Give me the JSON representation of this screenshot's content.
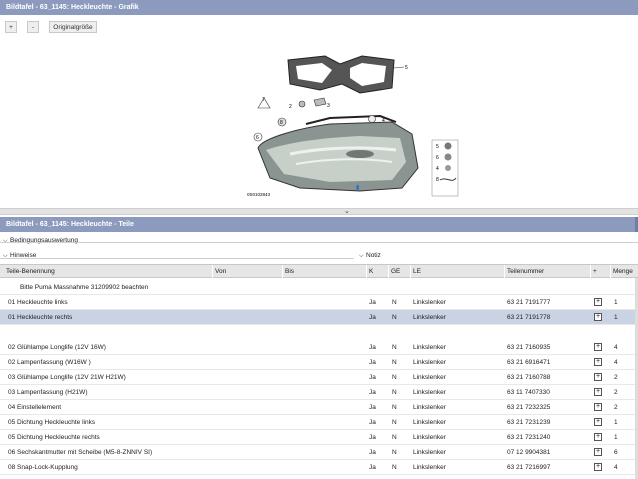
{
  "window": {
    "graphic_title": "Bildtafel - 63_1145: Heckleuchte - Grafik",
    "parts_title": "Bildtafel - 63_1145: Heckleuchte - Teile"
  },
  "toolbar": {
    "zoom_in": "+",
    "zoom_out": "-",
    "original_size": "Originalgröße"
  },
  "diagram": {
    "callouts": [
      "1",
      "2",
      "3",
      "4",
      "5",
      "6",
      "7",
      "8"
    ],
    "code": "0S0102843"
  },
  "splitter_icon": "chevron-down-icon",
  "sections": {
    "conditions": "Bedingungsauswertung",
    "hints": "Hinweise",
    "notes": "Notiz"
  },
  "table": {
    "columns": [
      "Teile-Benennung",
      "Von",
      "Bis",
      "K",
      "GE",
      "LE",
      "Teilenummer",
      "+",
      "Menge"
    ],
    "note_row": "Bitte Puma Massnahme 31209902 beachten",
    "rows": [
      {
        "name": "01 Heckleuchte links",
        "k": "Ja",
        "ge": "N",
        "le": "Linkslenker",
        "part": "63 21 7191777",
        "qty": "1"
      },
      {
        "name": "01 Heckleuchte rechts",
        "k": "Ja",
        "ge": "N",
        "le": "Linkslenker",
        "part": "63 21 7191778",
        "qty": "1"
      },
      {
        "name": "02 Glühlampe Longlife (12V 16W)",
        "k": "Ja",
        "ge": "N",
        "le": "Linkslenker",
        "part": "63 21 7160935",
        "qty": "4"
      },
      {
        "name": "02 Lampenfassung (W16W )",
        "k": "Ja",
        "ge": "N",
        "le": "Linkslenker",
        "part": "63 21 6916471",
        "qty": "4"
      },
      {
        "name": "03 Glühlampe Longlife (12V 21W H21W)",
        "k": "Ja",
        "ge": "N",
        "le": "Linkslenker",
        "part": "63 21 7160788",
        "qty": "2"
      },
      {
        "name": "03 Lampenfassung (H21W)",
        "k": "Ja",
        "ge": "N",
        "le": "Linkslenker",
        "part": "63 11 7407330",
        "qty": "2"
      },
      {
        "name": "04 Einstellelement",
        "k": "Ja",
        "ge": "N",
        "le": "Linkslenker",
        "part": "63 21 7232325",
        "qty": "2"
      },
      {
        "name": "05 Dichtung Heckleuchte links",
        "k": "Ja",
        "ge": "N",
        "le": "Linkslenker",
        "part": "63 21 7231239",
        "qty": "1"
      },
      {
        "name": "05 Dichtung Heckleuchte rechts",
        "k": "Ja",
        "ge": "N",
        "le": "Linkslenker",
        "part": "63 21 7231240",
        "qty": "1"
      },
      {
        "name": "06 Sechskantmutter mit Scheibe (M5-8-ZNNIV SI)",
        "k": "Ja",
        "ge": "N",
        "le": "Linkslenker",
        "part": "07 12 9904381",
        "qty": "6"
      },
      {
        "name": "08 Snap-Lock-Kupplung",
        "k": "Ja",
        "ge": "N",
        "le": "Linkslenker",
        "part": "63 21 7216997",
        "qty": "4"
      }
    ],
    "selected_index": 1
  },
  "colors": {
    "titlebar": "#8c9bbd",
    "selected_row": "#c9d3e3",
    "header": "#e6e6e6"
  }
}
